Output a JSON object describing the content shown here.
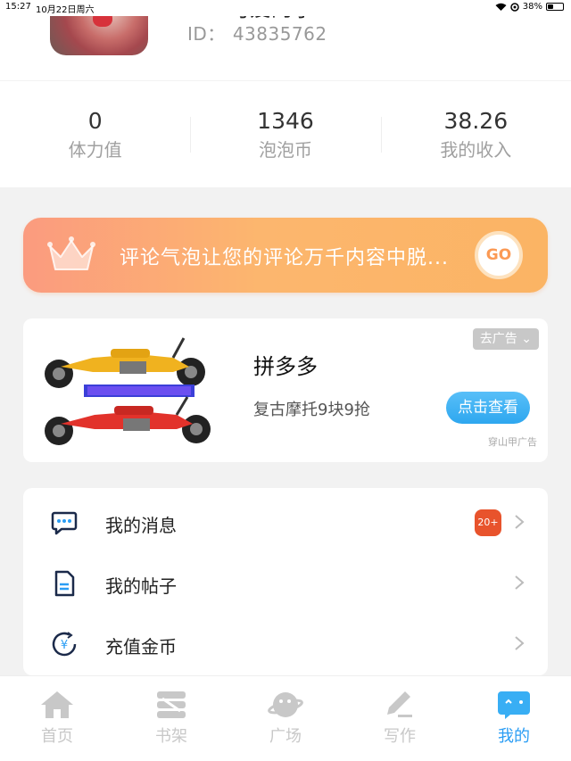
{
  "status_bar": {
    "time": "15:27",
    "date": "10月22日周六",
    "battery": "38%",
    "battery_level": 0.38
  },
  "profile": {
    "nickname": "可爱的小...",
    "id_label": "ID：",
    "id_value": "43835762"
  },
  "stats": [
    {
      "value": "0",
      "label": "体力值"
    },
    {
      "value": "1346",
      "label": "泡泡币"
    },
    {
      "value": "38.26",
      "label": "我的收入"
    }
  ],
  "banner": {
    "text": "评论气泡让您的评论万千内容中脱...",
    "go_label": "GO"
  },
  "ad": {
    "tag": "去广告",
    "title": "拼多多",
    "description": "复古摩托9块9抢",
    "button": "点击查看",
    "source": "穿山甲广告"
  },
  "menu": [
    {
      "label": "我的消息",
      "icon": "message-icon",
      "badge": "20+"
    },
    {
      "label": "我的帖子",
      "icon": "document-icon",
      "badge": ""
    },
    {
      "label": "充值金币",
      "icon": "coin-icon",
      "badge": ""
    }
  ],
  "tabs": [
    {
      "label": "首页",
      "icon": "home-icon"
    },
    {
      "label": "书架",
      "icon": "bookshelf-icon"
    },
    {
      "label": "广场",
      "icon": "planet-icon"
    },
    {
      "label": "写作",
      "icon": "pen-icon"
    },
    {
      "label": "我的",
      "icon": "profile-bubble-icon",
      "active": true
    }
  ],
  "colors": {
    "accent": "#2a9df4",
    "badge": "#e8532c",
    "banner_start": "#fb9b7f",
    "banner_end": "#fbb464"
  }
}
